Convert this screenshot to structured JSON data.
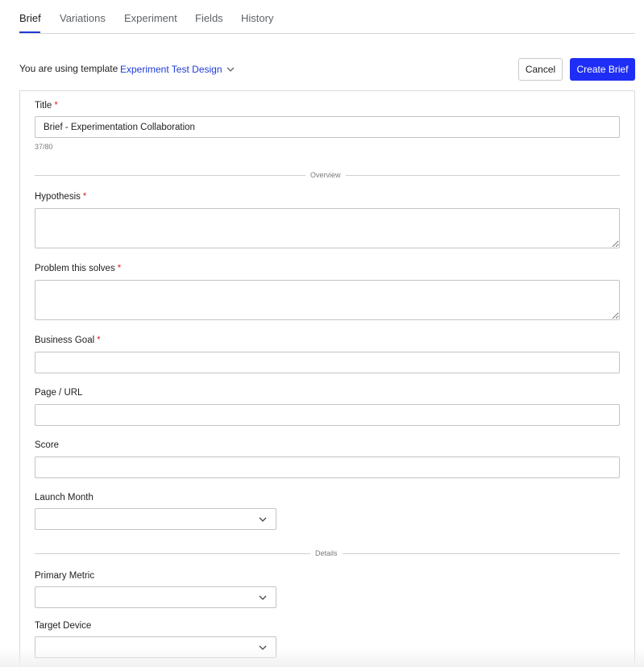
{
  "tabs": [
    {
      "label": "Brief",
      "active": true
    },
    {
      "label": "Variations",
      "active": false
    },
    {
      "label": "Experiment",
      "active": false
    },
    {
      "label": "Fields",
      "active": false
    },
    {
      "label": "History",
      "active": false
    }
  ],
  "template": {
    "prefix": "You are using template",
    "name": "Experiment Test Design"
  },
  "actions": {
    "cancel_label": "Cancel",
    "create_label": "Create Brief"
  },
  "form": {
    "title": {
      "label": "Title",
      "required_mark": "*",
      "value": "Brief - Experimentation Collaboration",
      "counter": "37/80"
    },
    "overview_heading": "Overview",
    "hypothesis": {
      "label": "Hypothesis",
      "required_mark": "*",
      "value": ""
    },
    "problem": {
      "label": "Problem this solves",
      "required_mark": "*",
      "value": ""
    },
    "business_goal": {
      "label": "Business Goal",
      "required_mark": "*",
      "value": ""
    },
    "page_url": {
      "label": "Page / URL",
      "value": ""
    },
    "score": {
      "label": "Score",
      "value": ""
    },
    "launch_month": {
      "label": "Launch Month",
      "value": ""
    },
    "details_heading": "Details",
    "primary_metric": {
      "label": "Primary Metric",
      "value": ""
    },
    "target_device": {
      "label": "Target Device",
      "value": ""
    }
  },
  "colors": {
    "accent": "#1f3bd6",
    "primary_button": "#1f2ef5",
    "required": "#e02424"
  },
  "icons": {
    "template_dropdown": "chevron-down-icon",
    "select_dropdown": "chevron-down-icon"
  }
}
